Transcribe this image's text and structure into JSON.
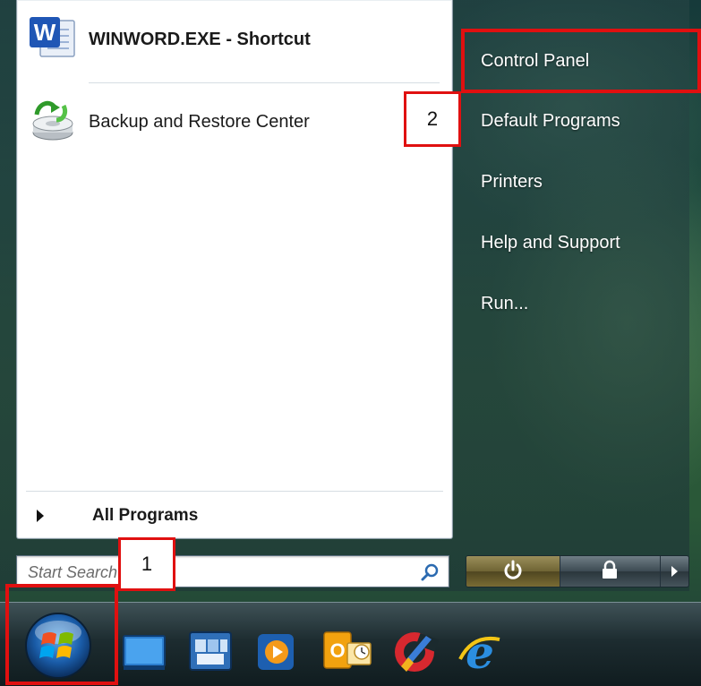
{
  "start_menu": {
    "pinned": [
      {
        "label": "WINWORD.EXE - Shortcut",
        "icon": "word-icon"
      },
      {
        "label": "Backup and Restore Center",
        "icon": "backup-restore-icon"
      }
    ],
    "all_programs_label": "All Programs",
    "search": {
      "placeholder": "Start Search",
      "value": ""
    },
    "right_items": [
      {
        "label": "Control Panel"
      },
      {
        "label": "Default Programs"
      },
      {
        "label": "Printers"
      },
      {
        "label": "Help and Support"
      },
      {
        "label": "Run..."
      }
    ],
    "power_buttons": [
      "power-icon",
      "lock-icon",
      "arrow-icon"
    ]
  },
  "taskbar": {
    "start_orb": "windows-start-orb-icon",
    "quick_launch": [
      "show-desktop-icon",
      "switch-windows-icon",
      "media-player-icon",
      "outlook-icon",
      "ccleaner-icon",
      "internet-explorer-icon"
    ]
  },
  "annotations": [
    {
      "label": "1",
      "color": "#e01010"
    },
    {
      "label": "2",
      "color": "#e01010"
    }
  ]
}
